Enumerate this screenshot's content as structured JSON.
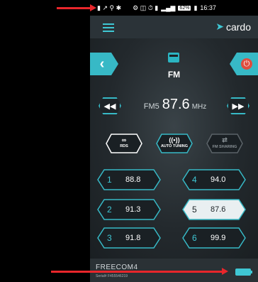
{
  "statusbar": {
    "battery": "62%",
    "time": "16:37"
  },
  "app": {
    "brand": "cardo"
  },
  "radio": {
    "band": "FM",
    "freq_prefix": "FM5",
    "frequency": "87.6",
    "unit": "MHz"
  },
  "features": [
    {
      "label": "RDS",
      "icon": "rds-icon",
      "active": true
    },
    {
      "label": "AUTO TUNING",
      "icon": "antenna-icon",
      "active": false
    },
    {
      "label": "FM SHARING",
      "icon": "share-icon",
      "active": false
    }
  ],
  "presets": [
    {
      "num": "1",
      "freq": "88.8",
      "active": false
    },
    {
      "num": "4",
      "freq": "94.0",
      "active": false
    },
    {
      "num": "2",
      "freq": "91.3",
      "active": false
    },
    {
      "num": "5",
      "freq": "87.6",
      "active": true
    },
    {
      "num": "3",
      "freq": "91.8",
      "active": false
    },
    {
      "num": "6",
      "freq": "99.9",
      "active": false
    }
  ],
  "device": {
    "name": "FREECOM4",
    "serial": "Serial# F455546219"
  },
  "colors": {
    "accent": "#37b9c6",
    "power": "#e04d3f",
    "annotation": "#e8262b",
    "background": "#1c2226"
  }
}
